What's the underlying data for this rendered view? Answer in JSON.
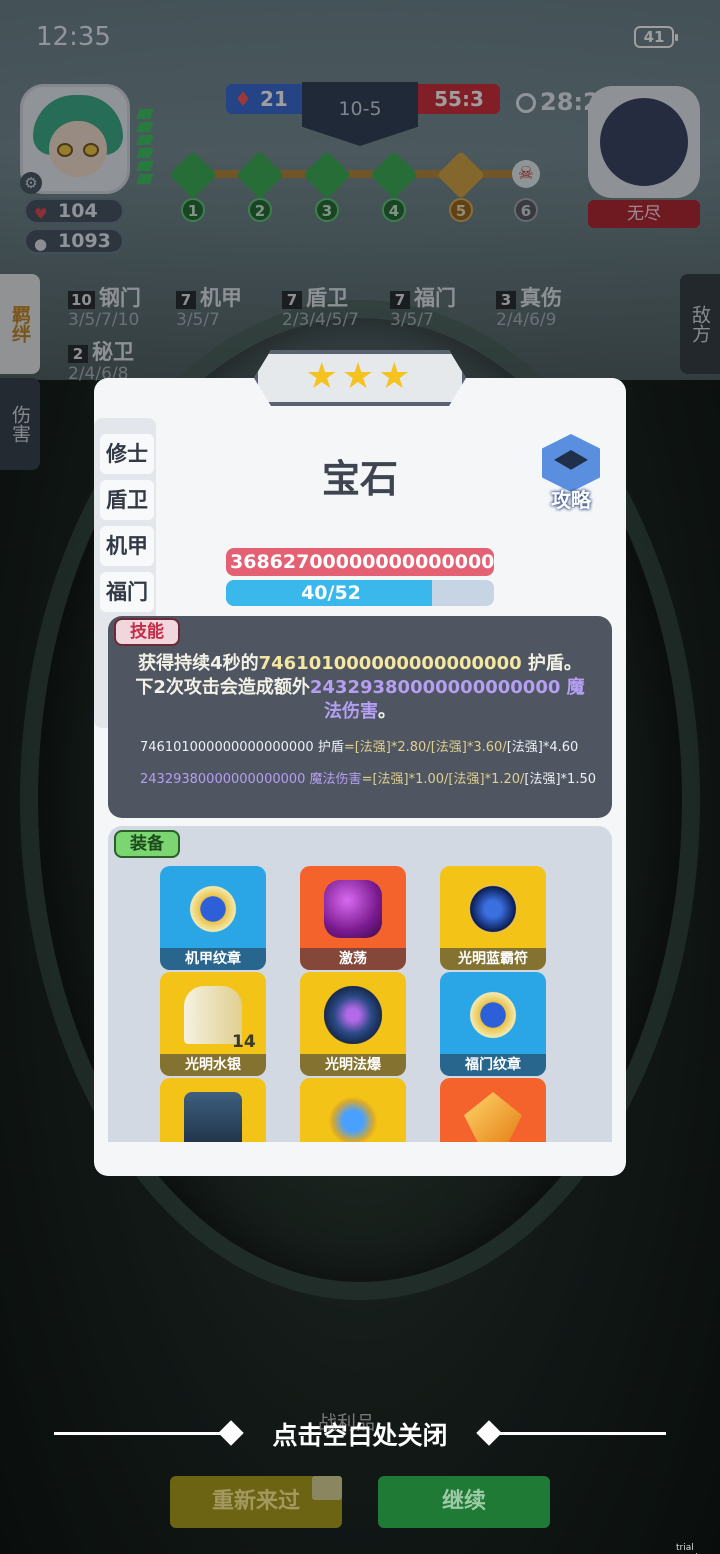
{
  "status_bar": {
    "time": "12:35",
    "battery": "41"
  },
  "hud": {
    "hp": "104",
    "gold": "1093",
    "blue_score": "21",
    "red_score": "55:3",
    "round": "10-5",
    "timer": "28:2",
    "enemy_name": "无尽",
    "stage_nodes": [
      "1",
      "2",
      "3",
      "4",
      "5",
      "6"
    ]
  },
  "side_tabs": {
    "left_active": "羁绊",
    "left_other": "伤害",
    "right": "敌方"
  },
  "synergies": [
    {
      "count": "10",
      "name": "钢门",
      "tiers": "3/5/7/10"
    },
    {
      "count": "7",
      "name": "机甲",
      "tiers": "3/5/7"
    },
    {
      "count": "7",
      "name": "盾卫",
      "tiers": "2/3/4/5/7"
    },
    {
      "count": "7",
      "name": "福门",
      "tiers": "3/5/7"
    },
    {
      "count": "3",
      "name": "真伤",
      "tiers": "2/4/6/9"
    },
    {
      "count": "2",
      "name": "秘卫",
      "tiers": "2/4/6/8"
    }
  ],
  "modal": {
    "stars": "★★★",
    "trait_tabs": [
      "修士",
      "盾卫",
      "机甲",
      "福门"
    ],
    "unit_name": "宝石",
    "guide_label": "攻略",
    "hp_text": "3686270000000000000000/",
    "mana_text": "40/52",
    "mana_fraction": 0.77,
    "skill_tag": "技能",
    "skill_desc": {
      "part1": "获得持续4秒的",
      "shield_value": "746101000000000000000",
      "part2": " 护盾。下2次攻击会造成额外",
      "magic_value": "24329380000000000000",
      "part3": " 魔法伤害",
      "part4": "。"
    },
    "formula1": {
      "value": "746101000000000000000",
      "unit": " 护盾",
      "expr": "=[法强]*2.80/[法强]*3.60/",
      "tail": "[法强]*4.60"
    },
    "formula2": {
      "value": "24329380000000000000",
      "unit": " 魔法伤害",
      "expr": "=[法强]*1.00/[法强]*1.20/",
      "tail": "[法强]*1.50"
    },
    "equip_tag": "装备",
    "equipment": [
      {
        "name": "机甲纹章",
        "bg": "#2aa6e6",
        "icon": "emblem-icon"
      },
      {
        "name": "激荡",
        "bg": "#f5632d",
        "icon": "orb-icon"
      },
      {
        "name": "光明蓝霸符",
        "bg": "#f4c318",
        "icon": "crystal-ball-icon"
      },
      {
        "name": "光明水银",
        "bg": "#f4c318",
        "icon": "cloak-icon",
        "badge": "14"
      },
      {
        "name": "光明法爆",
        "bg": "#f4c318",
        "icon": "dragon-helm-icon"
      },
      {
        "name": "福门纹章",
        "bg": "#2aa6e6",
        "icon": "emblem-icon"
      },
      {
        "name": "",
        "bg": "#f4c318",
        "icon": "armor-icon"
      },
      {
        "name": "",
        "bg": "#f4c318",
        "icon": "blue-gem-icon"
      },
      {
        "name": "",
        "bg": "#f5632d",
        "icon": "gold-crystal-icon"
      }
    ]
  },
  "footer": {
    "close_hint": "点击空白处关闭",
    "retry": "重新来过",
    "continue": "继续",
    "ghost_text": "战利品",
    "trial": "trial version"
  }
}
